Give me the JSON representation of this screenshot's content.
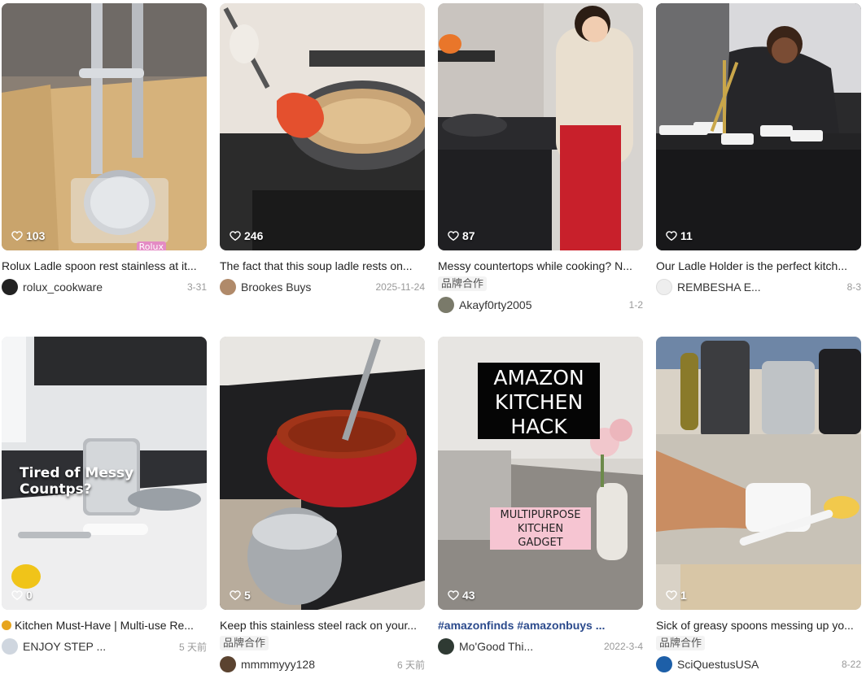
{
  "cards": [
    {
      "likes": "103",
      "title": "Rolux Ladle spoon rest stainless at it...",
      "author": "rolux_cookware",
      "date": "3-31",
      "collab": "",
      "overlay": {
        "brand": "Rolux"
      }
    },
    {
      "likes": "246",
      "title": "The fact that this soup ladle rests on...",
      "author": "Brookes Buys",
      "date": "2025-11-24",
      "collab": ""
    },
    {
      "likes": "87",
      "title": "Messy countertops while cooking? N...",
      "author": "Akayf0rty2005",
      "date": "1-2",
      "collab": "品牌合作"
    },
    {
      "likes": "11",
      "title": "Our Ladle Holder is the perfect kitch...",
      "author": "REMBESHA E...",
      "date": "8-3",
      "collab": ""
    },
    {
      "likes": "0",
      "title": "Kitchen Must-Have | Multi-use Re...",
      "author": "ENJOY STEP ...",
      "date": "5 天前",
      "collab": "",
      "overlay": {
        "caption": "Tired of Messy Countps?"
      }
    },
    {
      "likes": "5",
      "title": "Keep this stainless steel rack on your...",
      "author": "mmmmyyy128",
      "date": "6 天前",
      "collab": "品牌合作"
    },
    {
      "likes": "43",
      "title": "#amazonfinds #amazonbuys ...",
      "author": "Mo'Good Thi...",
      "date": "2022-3-4",
      "collab": "",
      "overlay": {
        "headline_1": "AMAZON",
        "headline_2": "KITCHEN",
        "headline_3": "HACK",
        "sub_1": "MULTIPURPOSE",
        "sub_2": "KITCHEN",
        "sub_3": "GADGET"
      }
    },
    {
      "likes": "1",
      "title": "Sick of greasy spoons messing up yo...",
      "author": "SciQuestusUSA",
      "date": "8-22",
      "collab": "品牌合作"
    }
  ],
  "icons": {
    "likes": "heart-outline-icon"
  },
  "colors": {
    "tag_text": "#2b4a8c",
    "date_text": "#999999",
    "collab_bg": "#f3f3f3"
  }
}
